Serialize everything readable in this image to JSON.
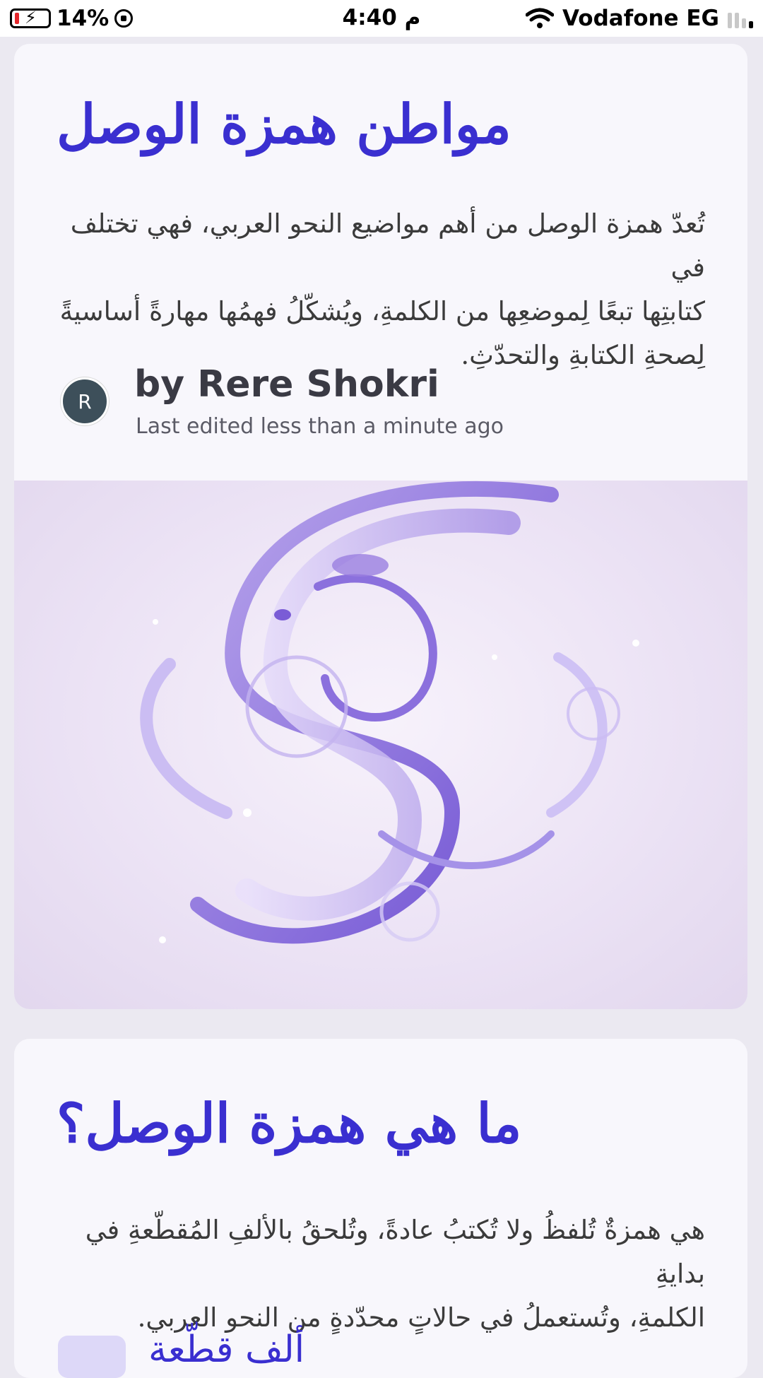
{
  "status_bar": {
    "battery_percent": "14%",
    "time": "4:40 م",
    "carrier": "Vodafone EG",
    "icons": [
      "battery-charging-icon",
      "rotation-lock-icon",
      "wifi-icon",
      "signal-icon"
    ]
  },
  "article": {
    "title": "مواطن همزة الوصل",
    "intro_lines": [
      "تُعدّ همزة الوصل من أهم مواضيع النحو العربي، فهي تختلف في",
      "كتابتِها تبعًا لِموضعِها من الكلمةِ، ويُشكّلُ فهمُها مهارةً أساسيةً",
      "لِصحةِ الكتابةِ والتحدّثِ."
    ],
    "author": {
      "avatar_initial": "R",
      "byline": "by Rere Shokri",
      "last_edited": "Last edited less than a minute ago"
    },
    "hero_image": "purple-calligraphy-swirl"
  },
  "section": {
    "title": "ما هي همزة الوصل؟",
    "body_lines": [
      "هي همزةٌ تُلفظُ ولا تُكتبُ عادةً، وتُلحقُ بالألفِ المُقطّعةِ في بدايةِ",
      "الكلمةِ، وتُستعملُ في حالاتٍ محدّدةٍ من النحو العربي."
    ],
    "next_item_label": "ألف قطّعة"
  },
  "colors": {
    "heading": "#3a2fd0",
    "body_text": "#3b3b3b",
    "card_bg": "#f8f7fc",
    "page_bg": "#ebe9f1"
  }
}
